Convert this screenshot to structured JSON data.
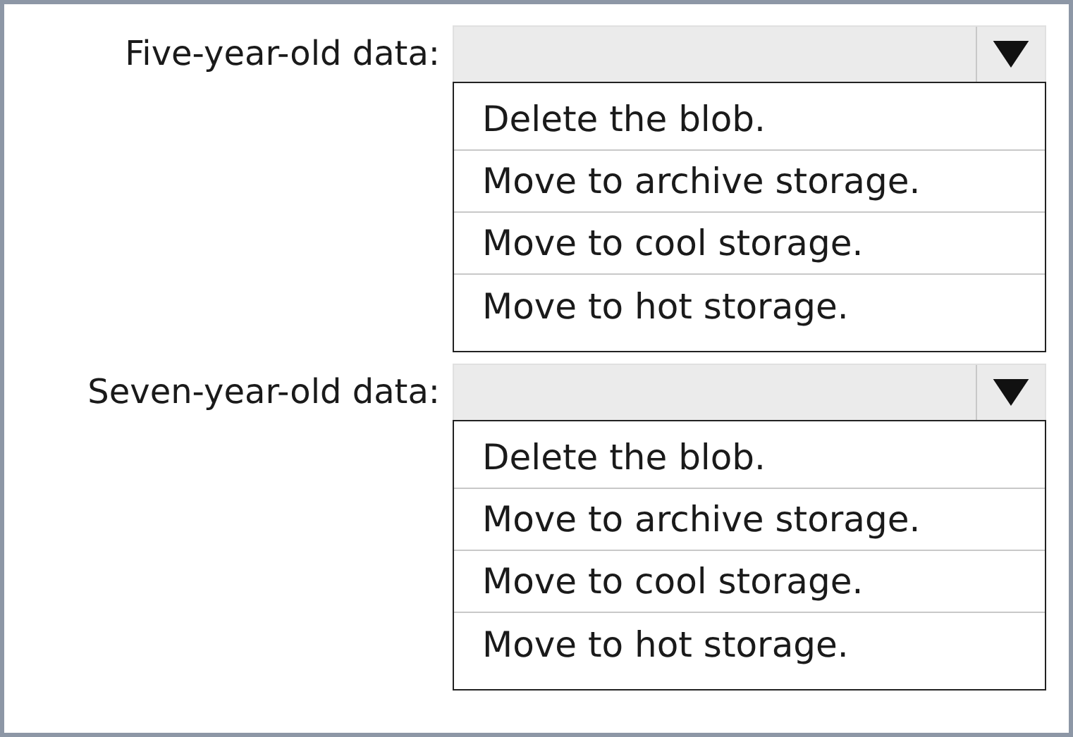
{
  "dropdowns": [
    {
      "label": "Five-year-old data:",
      "options": [
        "Delete the blob.",
        "Move to archive storage.",
        "Move to cool storage.",
        "Move to hot storage."
      ]
    },
    {
      "label": "Seven-year-old data:",
      "options": [
        "Delete the blob.",
        "Move to archive storage.",
        "Move to cool storage.",
        "Move to hot storage."
      ]
    }
  ]
}
